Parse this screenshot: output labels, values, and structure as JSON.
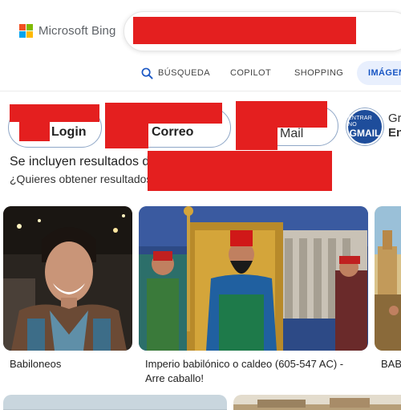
{
  "brand": {
    "name": "Microsoft Bing"
  },
  "tabs": [
    {
      "label": "BÚSQUEDA",
      "icon": "search-icon"
    },
    {
      "label": "COPILOT"
    },
    {
      "label": "SHOPPING"
    },
    {
      "label": "IMÁGENES"
    }
  ],
  "chips": [
    {
      "label": "Login"
    },
    {
      "label": "Correo"
    },
    {
      "label": "Mail"
    },
    {
      "icon_top": "ENTRAR NO",
      "icon_bottom": "GMAIL",
      "label_top": "Gr",
      "label_bottom": "En"
    }
  ],
  "notice": {
    "line1": "Se incluyen resultados d",
    "line2": "¿Quieres obtener resultados"
  },
  "results": [
    {
      "caption": "Babiloneos"
    },
    {
      "caption": "Imperio babilónico o caldeo (605-547 AC) - Arre caballo!"
    },
    {
      "caption": "BAB"
    }
  ],
  "colors": {
    "accent": "#1a57c4",
    "redaction": "#e41f1f",
    "tab_active_bg": "#e8effd"
  }
}
